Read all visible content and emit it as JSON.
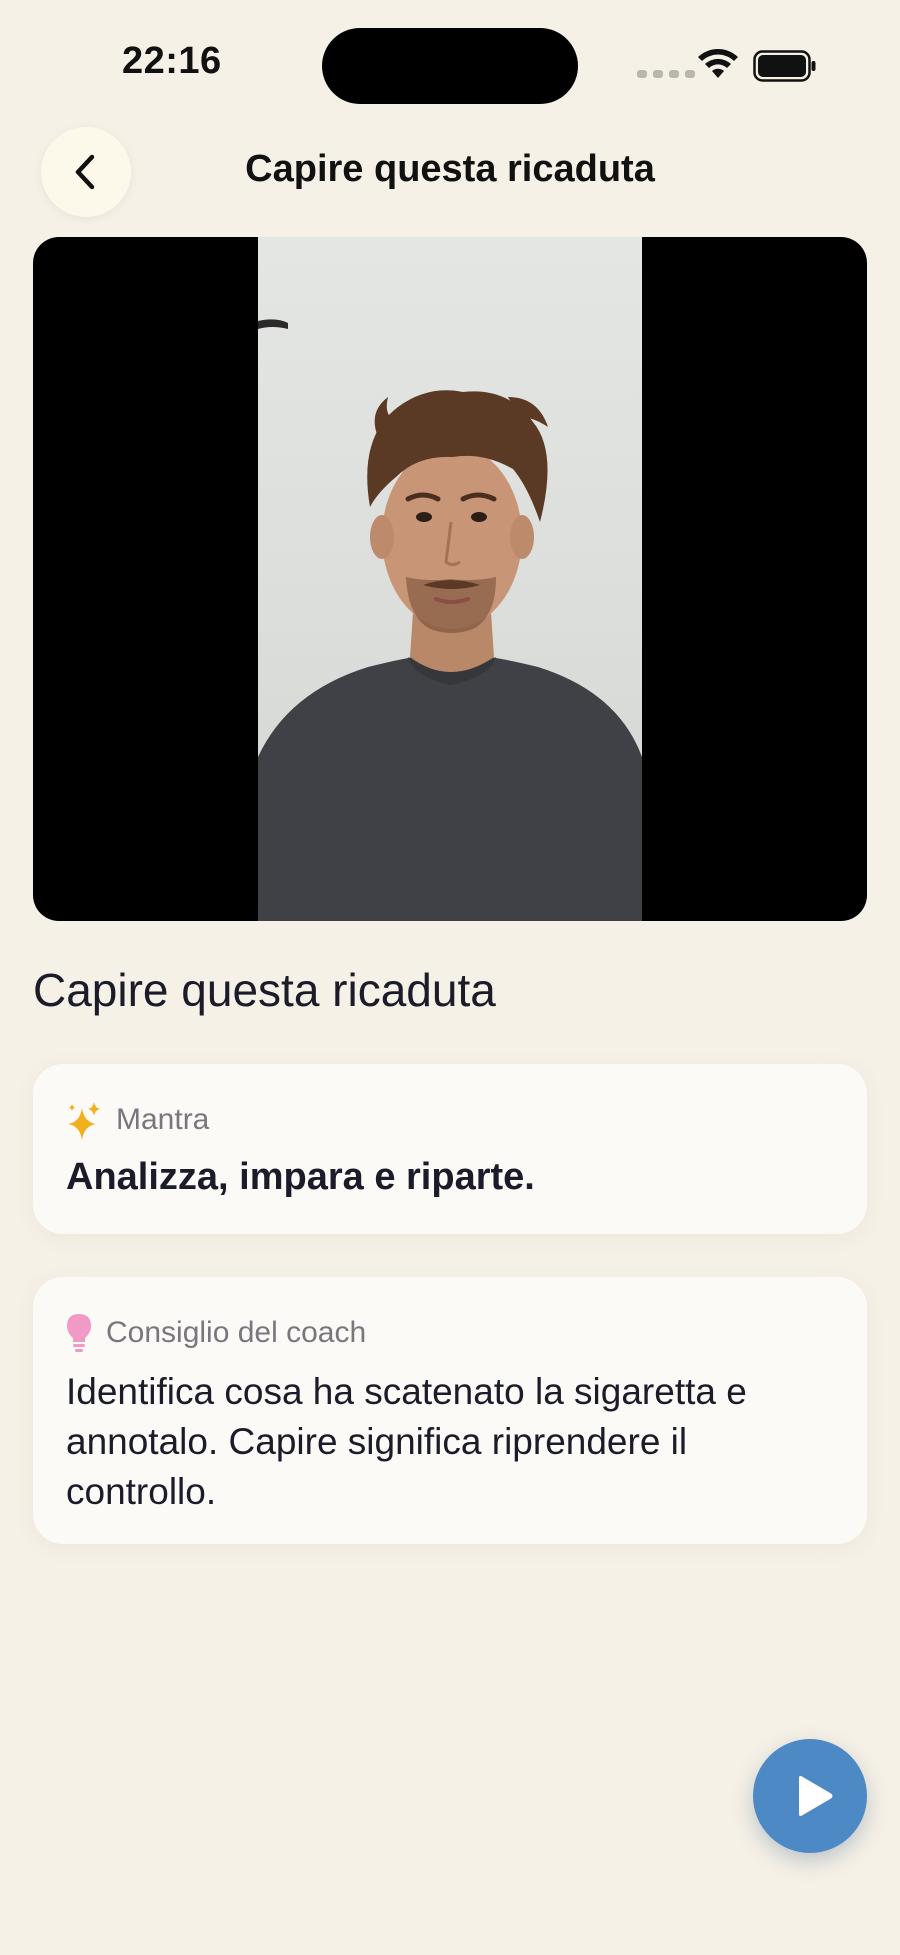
{
  "status_bar": {
    "time": "22:16"
  },
  "header": {
    "title": "Capire questa ricaduta",
    "back_icon": "chevron-left-icon"
  },
  "video": {
    "state": "paused"
  },
  "lesson": {
    "title": "Capire questa ricaduta"
  },
  "mantra_card": {
    "icon": "sparkles-icon",
    "label": "Mantra",
    "text": "Analizza, impara e riparte."
  },
  "coach_card": {
    "icon": "lightbulb-icon",
    "label": "Consiglio del coach",
    "text": "Identifica cosa ha scatenato la sigaretta e annotalo. Capire significa riprendere il controllo."
  },
  "play_button": {
    "icon": "play-icon"
  },
  "colors": {
    "background": "#f6f1e7",
    "card": "#fcfaf6",
    "accent_play": "#4d89c5",
    "sparkle": "#f2b01e",
    "bulb": "#f19ac6"
  }
}
